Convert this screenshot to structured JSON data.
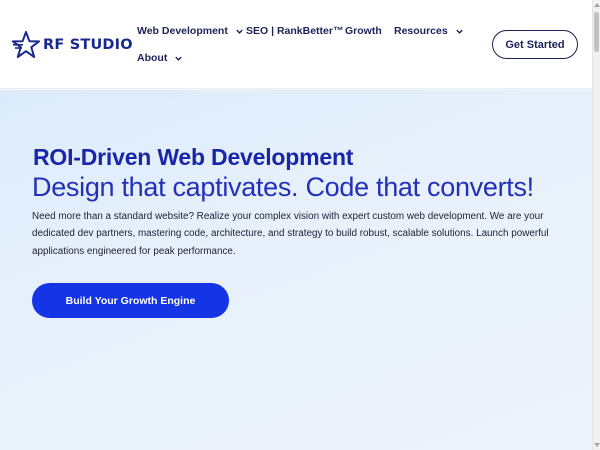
{
  "brand": {
    "name": "RF STUDIO",
    "accent_color": "#1a2a8c",
    "primary_color": "#1434e6"
  },
  "nav": {
    "items": [
      {
        "label": "Web Development",
        "has_dropdown": true
      },
      {
        "label": "SEO | RankBetter™",
        "has_dropdown": false
      },
      {
        "label": "Growth",
        "has_dropdown": false
      },
      {
        "label": "Resources",
        "has_dropdown": true
      },
      {
        "label": "About",
        "has_dropdown": true
      }
    ],
    "cta_label": "Get Started"
  },
  "hero": {
    "title": "ROI-Driven Web Development",
    "subtitle": "Design that captivates. Code that converts!",
    "description": "Need more than a standard website? Realize your complex vision with expert custom web development. We are your dedicated dev partners, mastering code, architecture, and strategy to build robust, scalable solutions. Launch powerful applications engineered for peak performance.",
    "button_label": "Build Your Growth Engine"
  },
  "icons": {
    "logo": "star-icon",
    "dropdown": "chevron-down-icon"
  }
}
